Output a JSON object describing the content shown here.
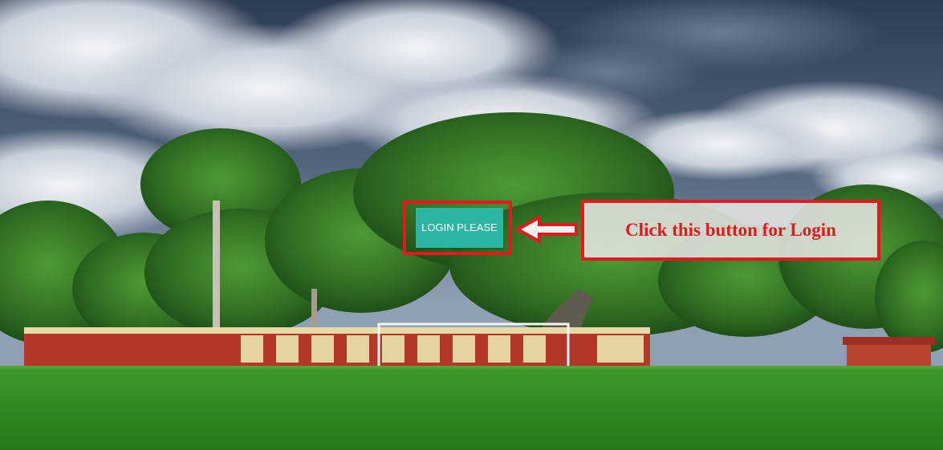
{
  "login_button": {
    "label": "LOGIN PLEASE",
    "background_color": "#2bb5a2"
  },
  "annotation": {
    "text": "Click this button for Login",
    "border_color": "#e3191f",
    "text_color": "#e3191f",
    "arrow_icon": "left-arrow-icon"
  },
  "background": {
    "scene": "landscape-photo",
    "colors": {
      "sky": "#3d4f66",
      "clouds": "#d9dde3",
      "trees": "#2f6a25",
      "grass": "#2e8b22"
    }
  }
}
